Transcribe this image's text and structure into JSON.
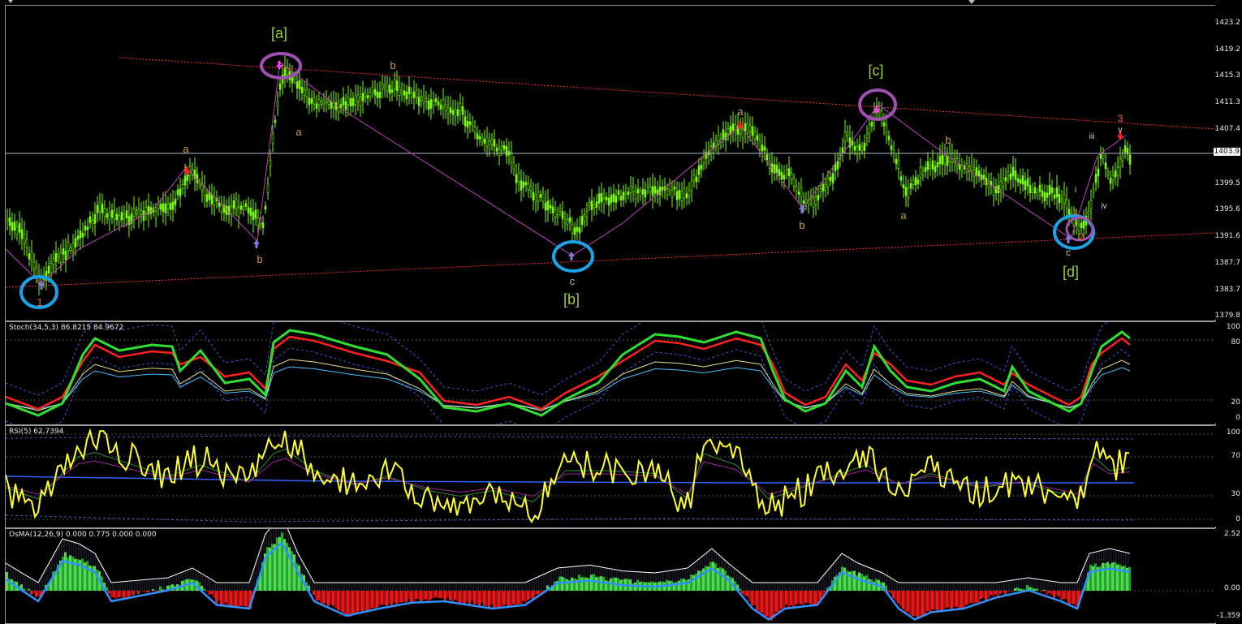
{
  "window": {
    "background": "#000000",
    "grid_color": "#9a9a9a"
  },
  "price_pane": {
    "axis": [
      "1423.2",
      "1419.2",
      "1415.3",
      "1411.3",
      "1407.4",
      "1403.9",
      "1399.5",
      "1395.6",
      "1391.6",
      "1387.7",
      "1383.7",
      "1379.8"
    ],
    "current_price": "1403.9",
    "wave_labels": {
      "a_big": "[a]",
      "b_big": "[b]",
      "c_big": "[c]",
      "d_big": "[d]",
      "a1": "a",
      "b1": "b",
      "a2": "a",
      "b2": "b",
      "c1": "c",
      "a3": "a",
      "b3": "b",
      "a4": "a",
      "b4": "b",
      "c2": "c",
      "n1": "1",
      "n2": "2",
      "n3": "3",
      "n1b": "1",
      "i": "i",
      "iii": "iii",
      "iv": "iv",
      "v": "v",
      "b5": "b",
      "a5": "a"
    },
    "colors": {
      "candle": "#7cfc00",
      "wave_label": "#c8a040",
      "big_label": "#9acd32",
      "red_line": "#ff3030",
      "magenta_line": "#c040c0",
      "blue_circle": "#1aa3e8",
      "purple_circle": "#a050b0"
    }
  },
  "stoch_pane": {
    "label": "Stoch(34,5,3) 86.8215 84.9672",
    "axis": [
      "100",
      "80",
      "20",
      "0"
    ]
  },
  "rsi_pane": {
    "label": "RSI(5) 62.7394",
    "axis": [
      "100",
      "70",
      "30",
      "0"
    ]
  },
  "osma_pane": {
    "label": "OsMA(12,26,9) 0.000 0.775 0.000 0.000",
    "axis": [
      "2.52",
      "0.00",
      "-1.359"
    ]
  }
}
